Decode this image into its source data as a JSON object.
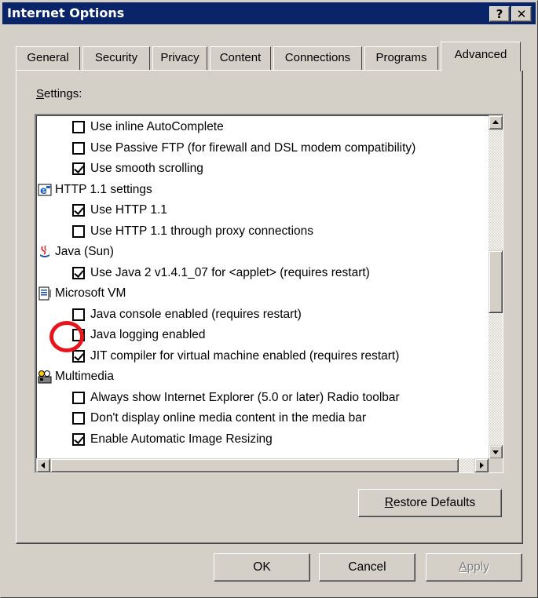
{
  "window": {
    "title": "Internet Options",
    "help_button": "?",
    "close_button": "✕"
  },
  "tabs": [
    {
      "label": "General"
    },
    {
      "label": "Security"
    },
    {
      "label": "Privacy"
    },
    {
      "label": "Content"
    },
    {
      "label": "Connections"
    },
    {
      "label": "Programs"
    },
    {
      "label": "Advanced",
      "active": true
    }
  ],
  "settings": {
    "label_prefix": "S",
    "label_rest": "ettings:",
    "items": [
      {
        "type": "checkbox",
        "checked": false,
        "label": "Use inline AutoComplete"
      },
      {
        "type": "checkbox",
        "checked": false,
        "label": "Use Passive FTP (for firewall and DSL modem compatibility)"
      },
      {
        "type": "checkbox",
        "checked": true,
        "label": "Use smooth scrolling"
      },
      {
        "type": "category",
        "icon": "ie-settings-icon",
        "label": "HTTP 1.1 settings"
      },
      {
        "type": "checkbox",
        "checked": true,
        "label": "Use HTTP 1.1"
      },
      {
        "type": "checkbox",
        "checked": false,
        "label": "Use HTTP 1.1 through proxy connections"
      },
      {
        "type": "category",
        "icon": "java-icon",
        "label": "Java (Sun)"
      },
      {
        "type": "checkbox",
        "checked": true,
        "label": "Use Java 2 v1.4.1_07 for <applet> (requires restart)"
      },
      {
        "type": "category",
        "icon": "document-icon",
        "label": "Microsoft VM"
      },
      {
        "type": "checkbox",
        "checked": false,
        "label": "Java console enabled (requires restart)"
      },
      {
        "type": "checkbox",
        "checked": false,
        "label": "Java logging enabled"
      },
      {
        "type": "checkbox",
        "checked": true,
        "label": "JIT compiler for virtual machine enabled (requires restart)"
      },
      {
        "type": "category",
        "icon": "multimedia-icon",
        "label": "Multimedia"
      },
      {
        "type": "checkbox",
        "checked": false,
        "label": "Always show Internet Explorer (5.0 or later) Radio toolbar"
      },
      {
        "type": "checkbox",
        "checked": false,
        "label": "Don't display online media content in the media bar"
      },
      {
        "type": "checkbox",
        "checked": true,
        "label": "Enable Automatic Image Resizing"
      }
    ]
  },
  "buttons": {
    "restore_prefix": "R",
    "restore_rest": "estore Defaults",
    "ok": "OK",
    "cancel": "Cancel",
    "apply_prefix": "A",
    "apply_rest": "pply"
  },
  "colors": {
    "titlebar": "#0a246a",
    "face": "#d4d0c8",
    "highlight_circle": "#e8141c"
  }
}
